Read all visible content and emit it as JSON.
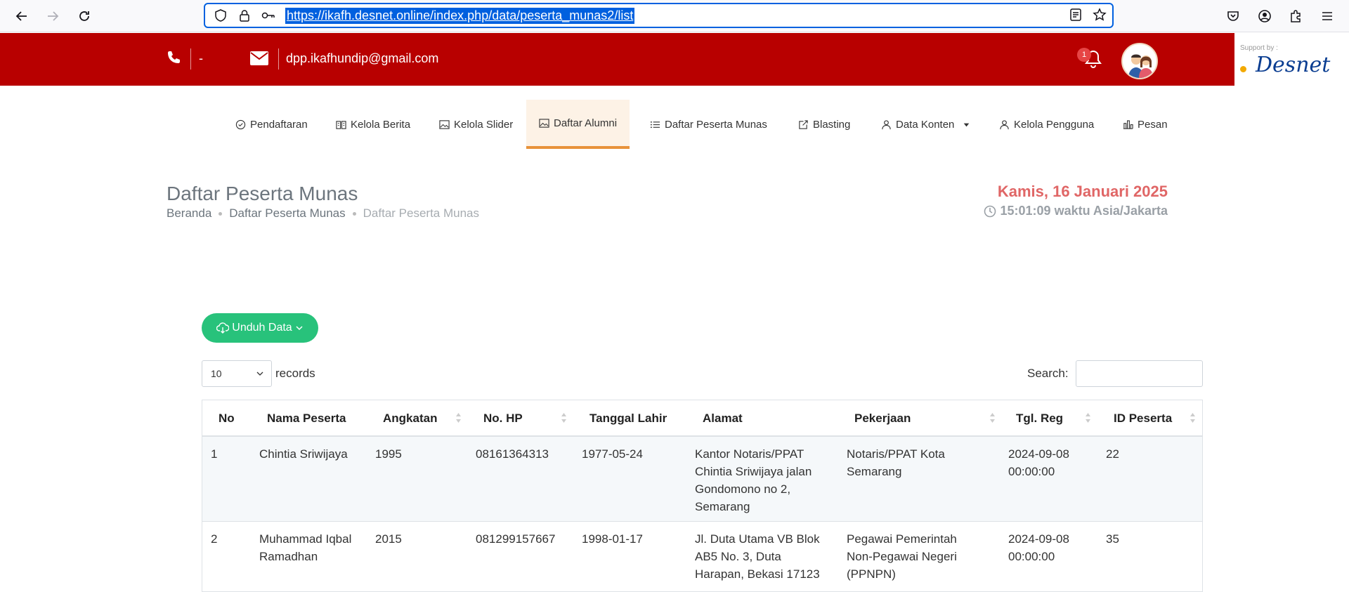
{
  "browser": {
    "url": "https://ikafh.desnet.online/index.php/data/peserta_munas2/list"
  },
  "header": {
    "phone": "-",
    "email": "dpp.ikafhundip@gmail.com",
    "notification_count": "1",
    "sponsor_label": "Support by :",
    "sponsor_logo": "Desnet"
  },
  "menu": [
    {
      "label": "Pendaftaran",
      "icon": "check-circle-icon"
    },
    {
      "label": "Kelola Berita",
      "icon": "book-icon"
    },
    {
      "label": "Kelola Slider",
      "icon": "image-icon"
    },
    {
      "label": "Daftar Alumni",
      "icon": "image-icon",
      "active": true
    },
    {
      "label": "Daftar Peserta Munas",
      "icon": "list-icon"
    },
    {
      "label": "Blasting",
      "icon": "share-icon"
    },
    {
      "label": "Data Konten",
      "icon": "users-icon"
    },
    {
      "label": "Kelola Pengguna",
      "icon": "user-icon"
    },
    {
      "label": "Pesan",
      "icon": "bar-chart-icon"
    }
  ],
  "page": {
    "title": "Daftar Peserta Munas",
    "breadcrumb": [
      "Beranda",
      "Daftar Peserta Munas",
      "Daftar Peserta Munas"
    ],
    "date": "Kamis, 16 Januari 2025",
    "time": "15:01:09 waktu Asia/Jakarta"
  },
  "toolbar": {
    "download_label": "Unduh Data",
    "page_length": "10",
    "records_label": "records",
    "search_label": "Search:"
  },
  "table": {
    "columns": [
      "No",
      "Nama Peserta",
      "Angkatan",
      "No. HP",
      "Tanggal Lahir",
      "Alamat",
      "Pekerjaan",
      "Tgl. Reg",
      "ID Peserta"
    ],
    "rows": [
      {
        "no": "1",
        "nama": "Chintia Sriwijaya",
        "angkatan": "1995",
        "hp": "08161364313",
        "lahir": "1977-05-24",
        "alamat": [
          "Kantor Notaris/PPAT",
          "Chintia Sriwijaya jalan",
          "Gondomono no 2,",
          "Semarang"
        ],
        "pekerjaan": [
          "Notaris/PPAT Kota",
          "Semarang"
        ],
        "reg": [
          "2024-09-08",
          "00:00:00"
        ],
        "id": "22"
      },
      {
        "no": "2",
        "nama": [
          "Muhammad Iqbal",
          "Ramadhan"
        ],
        "angkatan": "2015",
        "hp": "081299157667",
        "lahir": "1998-01-17",
        "alamat": [
          "Jl. Duta Utama VB Blok",
          "AB5 No. 3, Duta",
          "Harapan, Bekasi 17123"
        ],
        "pekerjaan": [
          "Pegawai Pemerintah",
          "Non-Pegawai Negeri",
          "(PPNPN)"
        ],
        "reg": [
          "2024-09-08",
          "00:00:00"
        ],
        "id": "35"
      }
    ]
  }
}
